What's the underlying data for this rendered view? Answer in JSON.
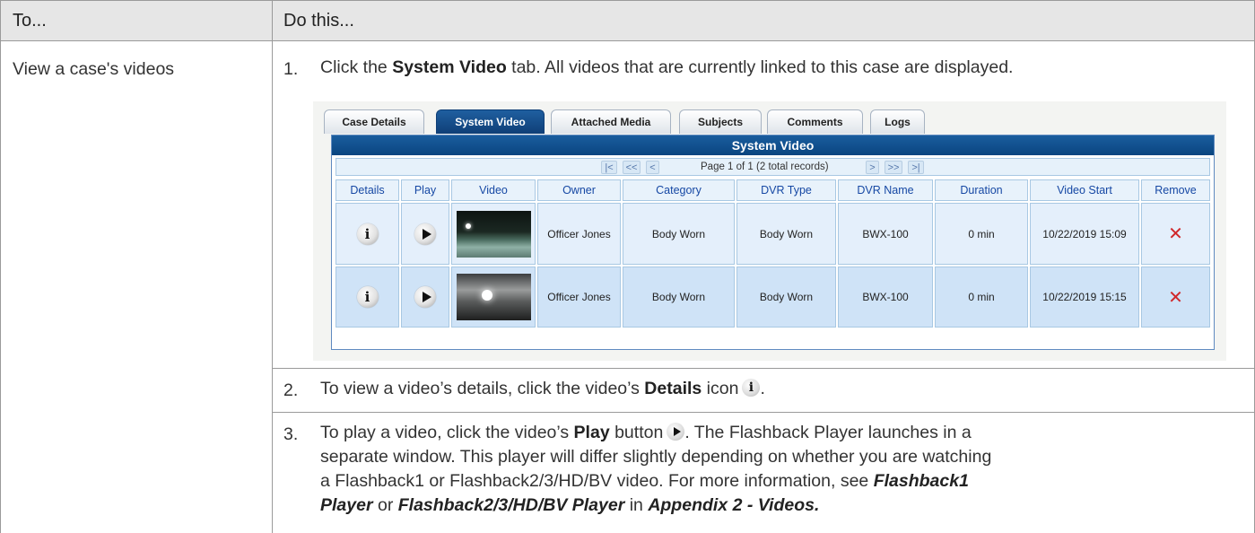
{
  "header": {
    "col1": "To...",
    "col2": "Do this..."
  },
  "row": {
    "task": "View a case's videos",
    "steps": [
      {
        "num": "1.",
        "pre": "Click the ",
        "bold": "System Video",
        "post": " tab. All videos that are currently linked to this case are displayed."
      },
      {
        "num": "2.",
        "pre": "To view a video’s details, click the video’s ",
        "bold": "Details",
        "post": " icon",
        "end": "."
      },
      {
        "num": "3.",
        "pre": "To play a video, click the video’s ",
        "bold": "Play",
        "post": " button",
        "line1_end": ". The Flashback Player launches in a",
        "line2": "separate window. This player will differ slightly depending on whether you are watching",
        "line3_pre": "a Flashback1 or Flashback2/3/HD/BV video. For more information, see ",
        "link1": "Flashback1",
        "line4_link1b": "Player",
        "line4_or": " or ",
        "link2": "Flashback2/3/HD/BV Player",
        "line4_in": " in ",
        "link3": "Appendix 2 - Videos."
      }
    ]
  },
  "screenshot": {
    "tabs": [
      "Case Details",
      "System Video",
      "Attached Media",
      "Subjects",
      "Comments",
      "Logs"
    ],
    "active_tab": "System Video",
    "grid_title": "System Video",
    "pager": {
      "first": "|<",
      "prev_page": "<<",
      "prev": "<",
      "text": "Page 1 of 1 (2 total records)",
      "next": ">",
      "next_page": ">>",
      "last": ">|"
    },
    "columns": [
      "Details",
      "Play",
      "Video",
      "Owner",
      "Category",
      "DVR Type",
      "DVR Name",
      "Duration",
      "Video Start",
      "Remove"
    ],
    "rows": [
      {
        "owner": "Officer Jones",
        "category": "Body Worn",
        "dvr_type": "Body Worn",
        "dvr_name": "BWX-100",
        "duration": "0 min",
        "video_start": "10/22/2019 15:09",
        "remove": "✕"
      },
      {
        "owner": "Officer Jones",
        "category": "Body Worn",
        "dvr_type": "Body Worn",
        "dvr_name": "BWX-100",
        "duration": "0 min",
        "video_start": "10/22/2019 15:15",
        "remove": "✕"
      }
    ],
    "icons": {
      "details": "info-icon",
      "play": "play-icon",
      "remove": "remove-icon"
    },
    "colors": {
      "active_tab": "#0f3f77",
      "title_bar": "#0a4580",
      "header_text": "#1648a4",
      "remove": "#d0282b"
    }
  }
}
